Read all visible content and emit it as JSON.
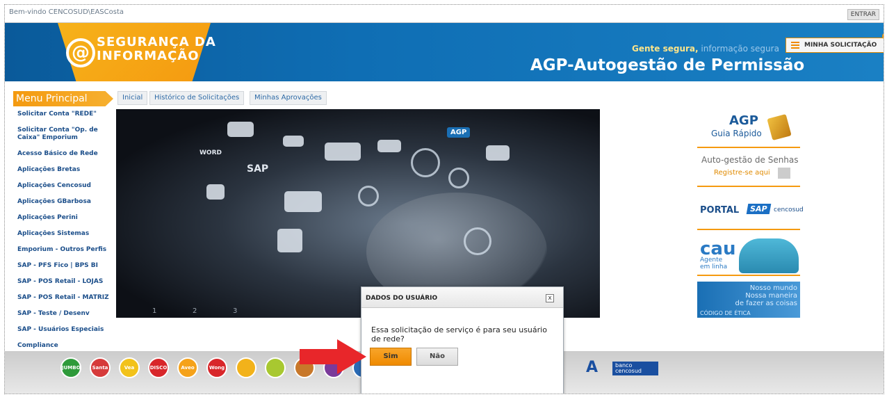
{
  "topbar": {
    "welcome": "Bem-vindo CENCOSUD\\EASCosta",
    "login_label": "ENTRAR"
  },
  "header": {
    "logo_line1": "SEGURANÇA DA",
    "logo_line2": "INFORMAÇÃO",
    "logo_symbol": "@",
    "tagline_bold": "Gente segura,",
    "tagline_light": "informação segura",
    "title": "AGP-Autogestão de Permissão",
    "my_request_label": "MINHA SOLICITAÇÃO"
  },
  "menu": {
    "title": "Menu Principal",
    "items": [
      "Solicitar Conta \"REDE\"",
      "Solicitar Conta \"Op. de Caixa\" Emporium",
      "Acesso Básico de Rede",
      "Aplicações Bretas",
      "Aplicações Cencosud",
      "Aplicações GBarbosa",
      "Aplicações Perini",
      "Aplicações Sistemas",
      "Emporium - Outros Perfis",
      "SAP - PFS Fico | BPS BI",
      "SAP - POS Retail - LOJAS",
      "SAP - POS Retail - MATRIZ",
      "SAP - Teste / Desenv",
      "SAP - Usuários Especiais",
      "Compliance"
    ]
  },
  "tabs": [
    "Inicial",
    "Histórico de Solicitações",
    "Minhas Aprovações"
  ],
  "hero": {
    "labels": {
      "sap": "SAP",
      "agp": "AGP",
      "word": "WORD"
    },
    "pages": [
      "1",
      "2",
      "3"
    ]
  },
  "side": {
    "agp_title": "AGP",
    "agp_sub": "Guia Rápido",
    "senha_title": "Auto-gestão de Senhas",
    "senha_link": "Registre-se aqui",
    "portal": "PORTAL",
    "portal_sap": "SAP",
    "portal_cencosud": "cencosud",
    "cau_title": "cau",
    "cau_line1": "Agente",
    "cau_line2": "em linha",
    "etica_l1": "Nosso mundo",
    "etica_l2": "Nossa maneira",
    "etica_l3": "de fazer as coisas",
    "etica_code": "CÓDIGO DE ÉTICA"
  },
  "brands": {
    "items": [
      "JUMBO",
      "Santa Isabel",
      "Vea",
      "DISCO",
      "Aveo",
      "Wong",
      "",
      "",
      "",
      "",
      "",
      "",
      ""
    ],
    "colors": [
      "#2e9a3a",
      "#d63a3a",
      "#f2c21a",
      "#d8262a",
      "#f5a21a",
      "#d8262a",
      "#f2b21a",
      "#a8c830",
      "#c8782a",
      "#7a3a9a",
      "#2a6ab4",
      "#8a3aa8",
      "#3a5ab4"
    ],
    "bank": "banco cencosud",
    "letter": "A"
  },
  "dialog": {
    "title": "DADOS DO USUÁRIO",
    "close": "x",
    "message": "Essa solicitação de serviço é para seu usuário de rede?",
    "yes": "Sim",
    "no": "Não"
  }
}
